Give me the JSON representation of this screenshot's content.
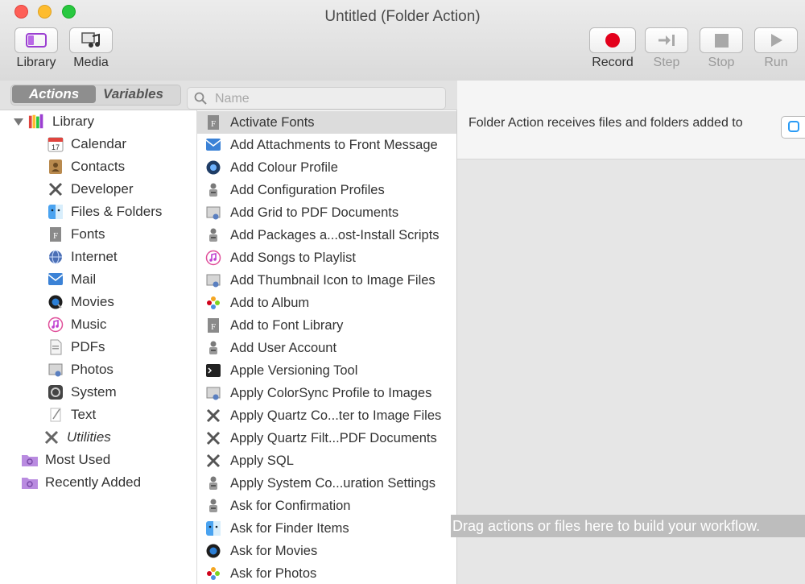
{
  "window": {
    "title": "Untitled (Folder Action)"
  },
  "toolbar": {
    "library_label": "Library",
    "media_label": "Media",
    "record_label": "Record",
    "step_label": "Step",
    "stop_label": "Stop",
    "run_label": "Run",
    "record_color": "#e3001b"
  },
  "tabs": {
    "actions": "Actions",
    "variables": "Variables"
  },
  "search": {
    "placeholder": "Name",
    "value": ""
  },
  "library": {
    "root": "Library",
    "categories": [
      {
        "label": "Calendar",
        "icon": "calendar-icon"
      },
      {
        "label": "Contacts",
        "icon": "contacts-icon"
      },
      {
        "label": "Developer",
        "icon": "developer-icon"
      },
      {
        "label": "Files & Folders",
        "icon": "finder-icon"
      },
      {
        "label": "Fonts",
        "icon": "fonts-icon"
      },
      {
        "label": "Internet",
        "icon": "internet-icon"
      },
      {
        "label": "Mail",
        "icon": "mail-icon"
      },
      {
        "label": "Movies",
        "icon": "movies-icon"
      },
      {
        "label": "Music",
        "icon": "music-icon"
      },
      {
        "label": "PDFs",
        "icon": "pdf-icon"
      },
      {
        "label": "Photos",
        "icon": "photos-icon"
      },
      {
        "label": "System",
        "icon": "system-icon"
      },
      {
        "label": "Text",
        "icon": "text-icon"
      },
      {
        "label": "Utilities",
        "icon": "utilities-icon"
      }
    ],
    "smart": [
      {
        "label": "Most Used",
        "icon": "smart-folder-icon"
      },
      {
        "label": "Recently Added",
        "icon": "smart-folder-icon"
      }
    ]
  },
  "actions": [
    {
      "label": "Activate Fonts",
      "icon": "fonts-icon",
      "selected": true
    },
    {
      "label": "Add Attachments to Front Message",
      "icon": "mail-icon"
    },
    {
      "label": "Add Colour Profile",
      "icon": "preview-icon"
    },
    {
      "label": "Add Configuration Profiles",
      "icon": "automator-icon"
    },
    {
      "label": "Add Grid to PDF Documents",
      "icon": "pdf-icon"
    },
    {
      "label": "Add Packages a...ost-Install Scripts",
      "icon": "automator-icon"
    },
    {
      "label": "Add Songs to Playlist",
      "icon": "music-icon"
    },
    {
      "label": "Add Thumbnail Icon to Image Files",
      "icon": "preview-icon"
    },
    {
      "label": "Add to Album",
      "icon": "photos-icon"
    },
    {
      "label": "Add to Font Library",
      "icon": "fonts-icon"
    },
    {
      "label": "Add User Account",
      "icon": "automator-icon"
    },
    {
      "label": "Apple Versioning Tool",
      "icon": "terminal-icon"
    },
    {
      "label": "Apply ColorSync Profile to Images",
      "icon": "preview-icon"
    },
    {
      "label": "Apply Quartz Co...ter to Image Files",
      "icon": "developer-icon"
    },
    {
      "label": "Apply Quartz Filt...PDF Documents",
      "icon": "developer-icon"
    },
    {
      "label": "Apply SQL",
      "icon": "developer-icon"
    },
    {
      "label": "Apply System Co...uration Settings",
      "icon": "automator-icon"
    },
    {
      "label": "Ask for Confirmation",
      "icon": "automator-icon"
    },
    {
      "label": "Ask for Finder Items",
      "icon": "finder-icon"
    },
    {
      "label": "Ask for Movies",
      "icon": "movies-icon"
    },
    {
      "label": "Ask for Photos",
      "icon": "photos-icon"
    }
  ],
  "workflow": {
    "receives_text": "Folder Action receives files and folders added to",
    "drop_hint": "Drag actions or files here to build your workflow."
  }
}
